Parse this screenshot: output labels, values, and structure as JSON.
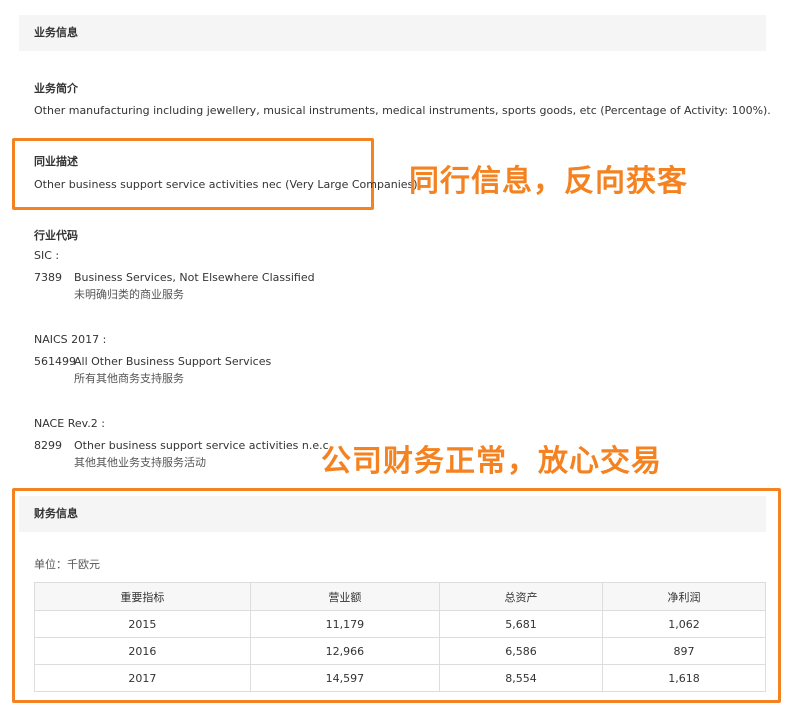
{
  "business": {
    "header": "业务信息",
    "intro_label": "业务简介",
    "intro_text": "Other manufacturing including jewellery, musical instruments, medical instruments, sports goods, etc (Percentage of Activity: 100%).",
    "peer_label": "同业描述",
    "peer_text": "Other business support service activities nec (Very Large Companies)",
    "codes_label": "行业代码",
    "sic": {
      "label": "SIC :",
      "code": "7389",
      "desc_en": "Business Services, Not Elsewhere Classified",
      "desc_cn": "未明确归类的商业服务"
    },
    "naics": {
      "label": "NAICS 2017 :",
      "code": "561499",
      "desc_en": "All Other Business Support Services",
      "desc_cn": "所有其他商务支持服务"
    },
    "nace": {
      "label": "NACE Rev.2 :",
      "code": "8299",
      "desc_en": "Other business support service activities n.e.c.",
      "desc_cn": "其他其他业务支持服务活动"
    }
  },
  "promo": {
    "peer_slogan": "同行信息，反向获客",
    "finance_slogan": "公司财务正常，放心交易"
  },
  "finance": {
    "header": "财务信息",
    "unit": "单位：千欧元",
    "columns": [
      "重要指标",
      "营业额",
      "总资产",
      "净利润"
    ],
    "rows": [
      [
        "2015",
        "11,179",
        "5,681",
        "1,062"
      ],
      [
        "2016",
        "12,966",
        "6,586",
        "897"
      ],
      [
        "2017",
        "14,597",
        "8,554",
        "1,618"
      ]
    ]
  },
  "colors": {
    "accent": "#f58220",
    "header_bg": "#f5f5f5"
  }
}
